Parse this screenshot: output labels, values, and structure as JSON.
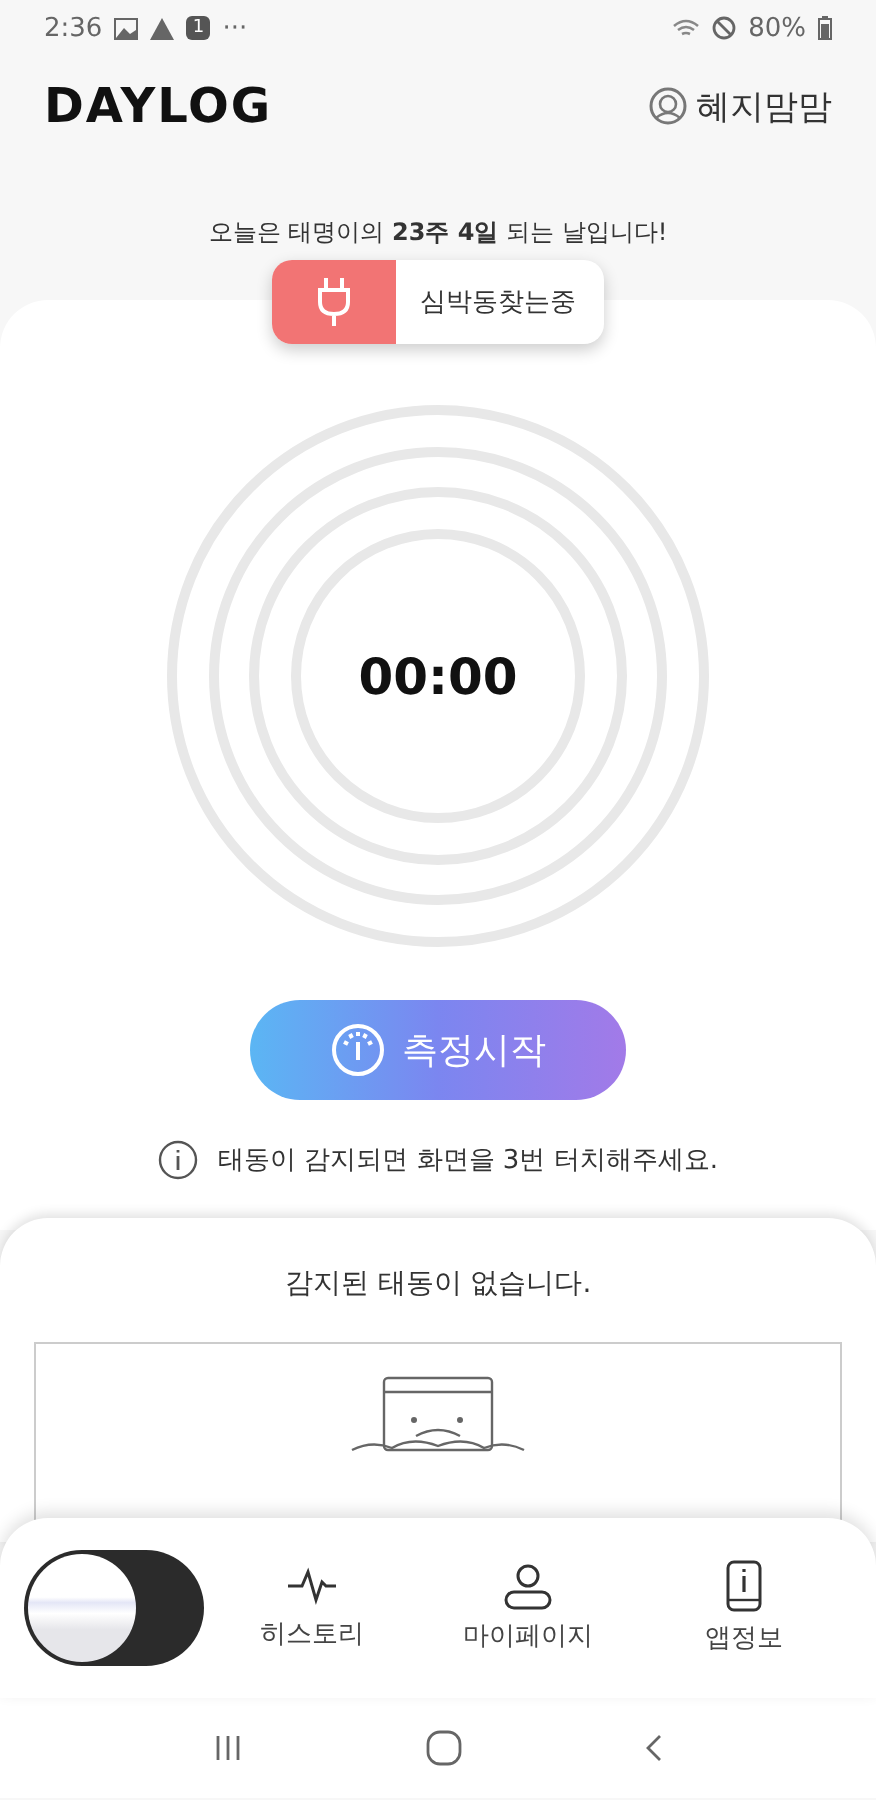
{
  "status_bar": {
    "time": "2:36",
    "notification_count": "1",
    "more": "···",
    "battery": "80%"
  },
  "header": {
    "logo": "DAYLOG",
    "user": "혜지맘맘"
  },
  "greeting": "오늘은 태명이의 **23주 4일** 되는 날입니다!",
  "connection": {
    "status": "심박동찾는중",
    "connected": false
  },
  "timer": {
    "value": "00:00"
  },
  "start_button": {
    "label": "측정시작"
  },
  "hint": "태동이 감지되면 화면을 3번 터치해주세요.",
  "history": {
    "message": "감지된 태동이 없습니다."
  },
  "bottom_nav": {
    "toggle": {
      "on": false
    },
    "items": [
      {
        "label": "히스토리",
        "kind": "pulse"
      },
      {
        "label": "마이페이지",
        "kind": "person"
      },
      {
        "label": "앱정보",
        "kind": "info"
      }
    ]
  }
}
